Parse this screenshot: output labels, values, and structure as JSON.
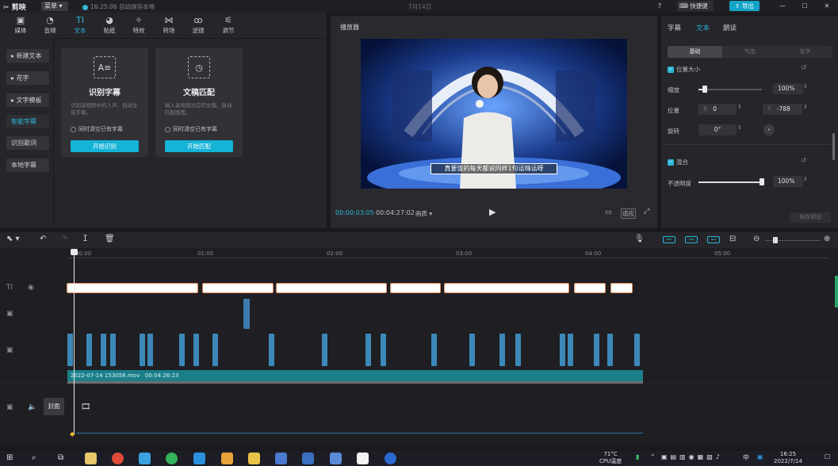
{
  "titlebar": {
    "app_name": "剪映",
    "menu_label": "菜单",
    "save_status": "16:25:06 自动保存本地",
    "project_date": "7月14日",
    "shortcut_label": "快捷键",
    "export_label": "导出"
  },
  "toolbar": {
    "items": [
      {
        "label": "媒体",
        "icon": "media-icon"
      },
      {
        "label": "音频",
        "icon": "audio-icon"
      },
      {
        "label": "文本",
        "icon": "text-icon"
      },
      {
        "label": "贴纸",
        "icon": "sticker-icon"
      },
      {
        "label": "特效",
        "icon": "effects-icon"
      },
      {
        "label": "转场",
        "icon": "transition-icon"
      },
      {
        "label": "滤镜",
        "icon": "filter-icon"
      },
      {
        "label": "调节",
        "icon": "adjust-icon"
      }
    ],
    "active": "文本"
  },
  "sidenav": {
    "items": [
      "新建文本",
      "花字",
      "文字模板",
      "智能字幕",
      "识别歌词",
      "本地字幕"
    ],
    "active": "智能字幕"
  },
  "cards": [
    {
      "title": "识别字幕",
      "description": "识别音视频中的人声，自动生成字幕。",
      "checkbox": "同时清空已有字幕",
      "button": "开始识别"
    },
    {
      "title": "文稿匹配",
      "description": "输入音视频对应的文稿，自动匹配画面。",
      "checkbox": "同时清空已有字幕",
      "button": "开始匹配"
    }
  ],
  "player": {
    "title": "播放器",
    "subtitle_text": "真要饭的每天都说同样1句话嗨话呀",
    "current_time": "00:00:03:05",
    "total_time": "00:04:27:02",
    "ratio_label": "画质",
    "fit_label": "适应"
  },
  "rightpanel": {
    "tabs": [
      "字幕",
      "文本",
      "朗读"
    ],
    "active_tab": "文本",
    "segments": [
      "基础",
      "气泡",
      "花字"
    ],
    "active_segment": "基础",
    "position_size_label": "位置大小",
    "scale_label": "缩放",
    "scale_value": "100%",
    "scale_fraction": 0.1,
    "position_label": "位置",
    "x_axis": "X",
    "x_value": "0",
    "y_axis": "Y",
    "y_value": "-788",
    "rotate_label": "旋转",
    "rotate_value": "0°",
    "blend_label": "混合",
    "opacity_label": "不透明度",
    "opacity_value": "100%",
    "opacity_fraction": 1.0,
    "preset_button": "保存预设"
  },
  "timeline": {
    "ruler": [
      "00:00",
      "01:00",
      "02:00",
      "03:00",
      "04:00",
      "05:00"
    ],
    "main_clip_name": "2022-07-14 153058.mov",
    "main_clip_duration": "00:04:26:23",
    "cover_label": "封面"
  },
  "taskbar": {
    "temperature": "71°C",
    "temp_label": "CPU温度",
    "ime": "中",
    "time": "16:25",
    "date": "2022/7/14"
  },
  "colors": {
    "accent": "#29b5d6",
    "button": "#15b3d6",
    "export": "#12a3c7",
    "main_clip": "#1b7f8a",
    "text_clip_border": "#e58a5a"
  }
}
